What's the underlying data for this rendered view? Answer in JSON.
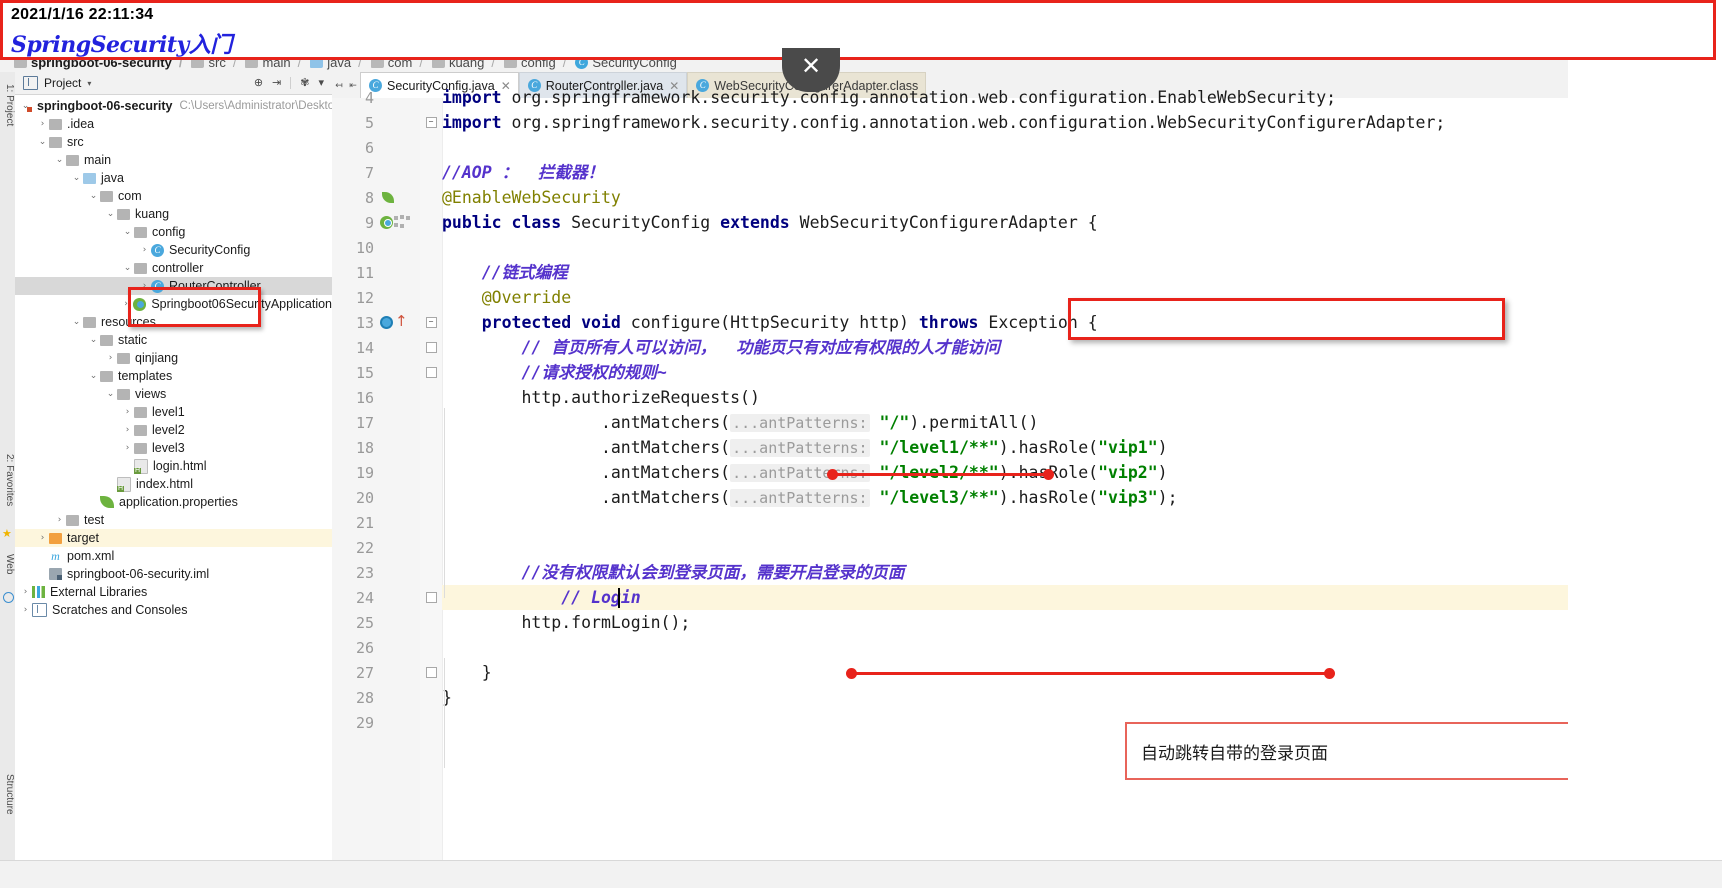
{
  "note": {
    "timestamp": "2021/1/16 22:11:34",
    "title": "SpringSecurity入门",
    "border_color": "#e8231b"
  },
  "breadcrumb": {
    "items": [
      {
        "label": "springboot-06-security",
        "icon": "module-icon"
      },
      {
        "label": "src",
        "icon": "folder-icon"
      },
      {
        "label": "main",
        "icon": "folder-icon"
      },
      {
        "label": "java",
        "icon": "folder-icon"
      },
      {
        "label": "com",
        "icon": "folder-icon"
      },
      {
        "label": "kuang",
        "icon": "folder-icon"
      },
      {
        "label": "config",
        "icon": "folder-icon"
      },
      {
        "label": "SecurityConfig",
        "icon": "class-icon"
      }
    ]
  },
  "tool_strips": {
    "left": [
      {
        "label": "1: Project",
        "name": "vtab-project"
      },
      {
        "label": "2: Favorites",
        "name": "vtab-favorites"
      },
      {
        "label": "Web",
        "name": "vtab-web"
      },
      {
        "label": "Structure",
        "name": "vtab-structure"
      }
    ]
  },
  "project_panel": {
    "title": "Project",
    "toolbar_icons": [
      "target-icon",
      "collapse-all-icon",
      "gear-icon"
    ],
    "tree": [
      {
        "depth": 0,
        "twisty": "v",
        "icon": "module-icon",
        "label": "springboot-06-security",
        "bold": true,
        "path": "C:\\Users\\Administrator\\Desktop",
        "state": "normal"
      },
      {
        "depth": 1,
        "twisty": ">",
        "icon": "folder-icon",
        "label": ".idea",
        "state": "normal"
      },
      {
        "depth": 1,
        "twisty": "v",
        "icon": "folder-src-icon",
        "label": "src",
        "state": "normal"
      },
      {
        "depth": 2,
        "twisty": "v",
        "icon": "folder-icon",
        "label": "main",
        "state": "normal"
      },
      {
        "depth": 3,
        "twisty": "v",
        "icon": "folder-blue-icon",
        "label": "java",
        "state": "normal"
      },
      {
        "depth": 4,
        "twisty": "v",
        "icon": "folder-icon",
        "label": "com",
        "state": "normal"
      },
      {
        "depth": 5,
        "twisty": "v",
        "icon": "folder-icon",
        "label": "kuang",
        "state": "normal"
      },
      {
        "depth": 6,
        "twisty": "v",
        "icon": "folder-icon",
        "label": "config",
        "state": "normal"
      },
      {
        "depth": 7,
        "twisty": ">",
        "icon": "class-icon",
        "label": "SecurityConfig",
        "state": "normal"
      },
      {
        "depth": 6,
        "twisty": "v",
        "icon": "folder-icon",
        "label": "controller",
        "state": "normal"
      },
      {
        "depth": 7,
        "twisty": ">",
        "icon": "class-icon",
        "label": "RouterController",
        "state": "selected"
      },
      {
        "depth": 6,
        "twisty": ">",
        "icon": "spring-class-icon",
        "label": "Springboot06SecurityApplication",
        "state": "normal"
      },
      {
        "depth": 3,
        "twisty": "v",
        "icon": "folder-res-icon",
        "label": "resources",
        "state": "normal"
      },
      {
        "depth": 4,
        "twisty": "v",
        "icon": "folder-icon",
        "label": "static",
        "state": "normal"
      },
      {
        "depth": 5,
        "twisty": ">",
        "icon": "folder-icon",
        "label": "qinjiang",
        "state": "normal"
      },
      {
        "depth": 4,
        "twisty": "v",
        "icon": "folder-icon",
        "label": "templates",
        "state": "normal"
      },
      {
        "depth": 5,
        "twisty": "v",
        "icon": "folder-icon",
        "label": "views",
        "state": "normal"
      },
      {
        "depth": 6,
        "twisty": ">",
        "icon": "folder-icon",
        "label": "level1",
        "state": "normal"
      },
      {
        "depth": 6,
        "twisty": ">",
        "icon": "folder-icon",
        "label": "level2",
        "state": "normal"
      },
      {
        "depth": 6,
        "twisty": ">",
        "icon": "folder-icon",
        "label": "level3",
        "state": "normal"
      },
      {
        "depth": 6,
        "twisty": "",
        "icon": "html-icon",
        "label": "login.html",
        "state": "normal"
      },
      {
        "depth": 5,
        "twisty": "",
        "icon": "html-icon",
        "label": "index.html",
        "state": "normal"
      },
      {
        "depth": 4,
        "twisty": "",
        "icon": "properties-icon",
        "label": "application.properties",
        "state": "normal"
      },
      {
        "depth": 2,
        "twisty": ">",
        "icon": "folder-icon",
        "label": "test",
        "state": "normal"
      },
      {
        "depth": 1,
        "twisty": ">",
        "icon": "folder-orange-icon",
        "label": "target",
        "state": "highlighted"
      },
      {
        "depth": 1,
        "twisty": "",
        "icon": "maven-icon",
        "label": "pom.xml",
        "state": "normal"
      },
      {
        "depth": 1,
        "twisty": "",
        "icon": "iml-icon",
        "label": "springboot-06-security.iml",
        "state": "normal"
      },
      {
        "depth": 0,
        "twisty": ">",
        "icon": "libraries-icon",
        "label": "External Libraries",
        "state": "normal"
      },
      {
        "depth": 0,
        "twisty": ">",
        "icon": "scratches-icon",
        "label": "Scratches and Consoles",
        "state": "normal"
      }
    ]
  },
  "editor": {
    "tabs": [
      {
        "label": "SecurityConfig.java",
        "icon": "java-class-icon",
        "active": true,
        "closable": true
      },
      {
        "label": "RouterController.java",
        "icon": "java-class-icon",
        "active": false,
        "closable": true
      },
      {
        "label": "WebSecurityConfigurerAdapter.class",
        "icon": "compiled-class-icon",
        "active": false,
        "closable": false
      }
    ],
    "lines": [
      {
        "num": 4,
        "gutter": "",
        "text_html": "<span class=\"kw\">import</span> org.springframework.security.config.annotation.web.configuration.<span style=\"color:#1b1b1b\">EnableWebSecurity</span>;"
      },
      {
        "num": 5,
        "gutter": "",
        "text_html": "<span class=\"kw\">import</span> org.springframework.security.config.annotation.web.configuration.WebSecurityConfigurerAdapter;"
      },
      {
        "num": 6,
        "gutter": "",
        "text_html": ""
      },
      {
        "num": 7,
        "gutter": "",
        "text_html": "<span class=\"cmt\">//AOP ：  拦截器！</span>"
      },
      {
        "num": 8,
        "gutter": "spring",
        "text_html": "<span class=\"ann\">@EnableWebSecurity</span>"
      },
      {
        "num": 9,
        "gutter": "bean",
        "text_html": "<span class=\"kw\">public class</span> SecurityConfig <span class=\"kw\">extends</span> WebSecurityConfigurerAdapter {"
      },
      {
        "num": 10,
        "gutter": "",
        "text_html": ""
      },
      {
        "num": 11,
        "gutter": "",
        "text_html": "    <span class=\"cmt\">//链式编程</span>"
      },
      {
        "num": 12,
        "gutter": "",
        "text_html": "    <span class=\"ann\">@Override</span>"
      },
      {
        "num": 13,
        "gutter": "override",
        "text_html": "    <span class=\"kw\">protected void</span> configure(HttpSecurity http) <span class=\"kw\">throws</span> Exception {"
      },
      {
        "num": 14,
        "gutter": "",
        "text_html": "        <span class=\"cmt\">// 首页所有人可以访问，  功能页只有对应有权限的人才能访问</span>"
      },
      {
        "num": 15,
        "gutter": "",
        "text_html": "        <span class=\"cmt\">//请求授权的规则~</span>"
      },
      {
        "num": 16,
        "gutter": "",
        "text_html": "        http.authorizeRequests()"
      },
      {
        "num": 17,
        "gutter": "",
        "text_html": "                .antMatchers(<span class=\"hint\">...antPatterns:</span> <span class=\"str\">\"/\"</span>).permitAll()"
      },
      {
        "num": 18,
        "gutter": "",
        "text_html": "                .antMatchers(<span class=\"hint\">...antPatterns:</span> <span class=\"str\">\"/level1/**\"</span>).hasRole(<span class=\"str\">\"vip1\"</span>)"
      },
      {
        "num": 19,
        "gutter": "",
        "text_html": "                .antMatchers(<span class=\"hint\">...antPatterns:</span> <span class=\"str\">\"/level2/**\"</span>).hasRole(<span class=\"str\">\"vip2\"</span>)"
      },
      {
        "num": 20,
        "gutter": "",
        "text_html": "                .antMatchers(<span class=\"hint\">...antPatterns:</span> <span class=\"str\">\"/level3/**\"</span>).hasRole(<span class=\"str\">\"vip3\"</span>);"
      },
      {
        "num": 21,
        "gutter": "",
        "text_html": ""
      },
      {
        "num": 22,
        "gutter": "",
        "text_html": ""
      },
      {
        "num": 23,
        "gutter": "",
        "text_html": "        <span class=\"cmt\">//没有权限默认会到登录页面，需要开启登录的页面</span>"
      },
      {
        "num": 24,
        "gutter": "",
        "text_html": "            <span class=\"cmt\">// Login</span>",
        "caret": true
      },
      {
        "num": 25,
        "gutter": "",
        "text_html": "        http.formLogin();"
      },
      {
        "num": 26,
        "gutter": "",
        "text_html": ""
      },
      {
        "num": 27,
        "gutter": "",
        "text_html": "    }"
      },
      {
        "num": 28,
        "gutter": "",
        "text_html": "}"
      },
      {
        "num": 29,
        "gutter": "",
        "text_html": ""
      }
    ]
  },
  "annotations": {
    "callout_text": "自动跳转自带的登录页面",
    "callout_border_color": "#e8645a",
    "highlight_color": "#e8231b",
    "underlines": [
      {
        "name": "underline-request-rule"
      },
      {
        "name": "underline-login-comment"
      }
    ]
  },
  "overlay": {
    "close_label": "✕"
  }
}
